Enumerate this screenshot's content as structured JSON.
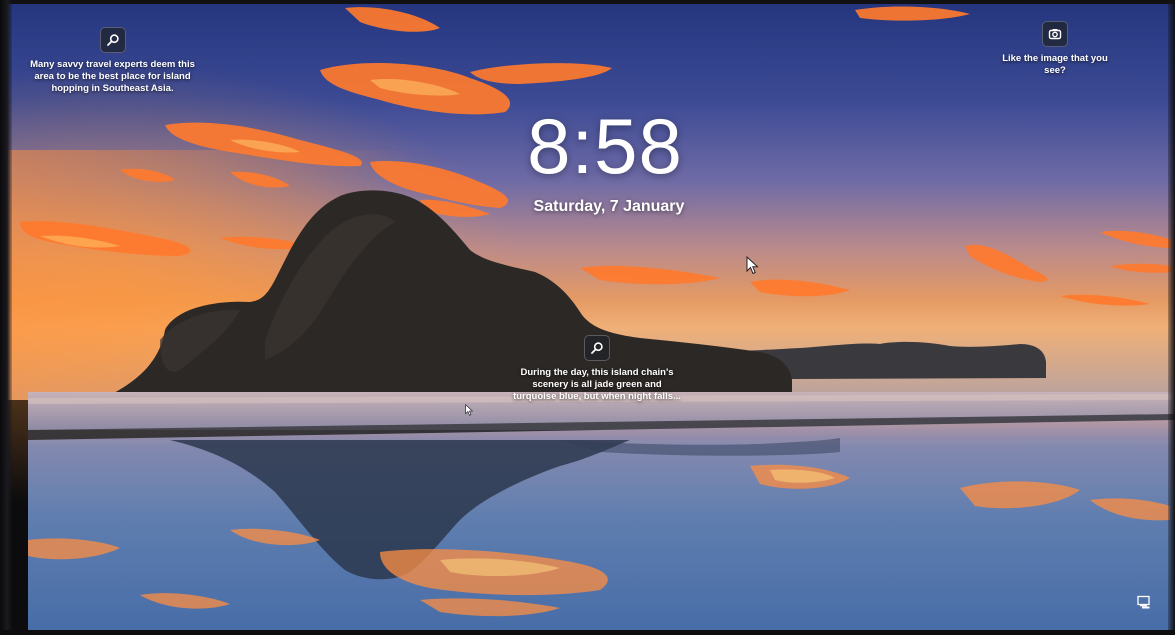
{
  "lock_screen": {
    "time": "8:58",
    "date": "Saturday, 7 January"
  },
  "hotspots": [
    {
      "icon": "search-icon",
      "text": "Many savvy travel experts deem this area to be the best place for island hopping in Southeast Asia."
    },
    {
      "icon": "search-icon",
      "text": "During the day, this island chain's scenery is all jade green and turquoise blue, but when night falls..."
    },
    {
      "icon": "camera-icon",
      "text": "Like the image that you see?"
    }
  ],
  "status_icon": "network-icon",
  "colors": {
    "sky_top": "#2b3f88",
    "sky_mid": "#6d6aa8",
    "horizon": "#e88a48",
    "cloud": "#ff7a2e",
    "island": "#2e2a28",
    "water": "#4a6a9e"
  }
}
